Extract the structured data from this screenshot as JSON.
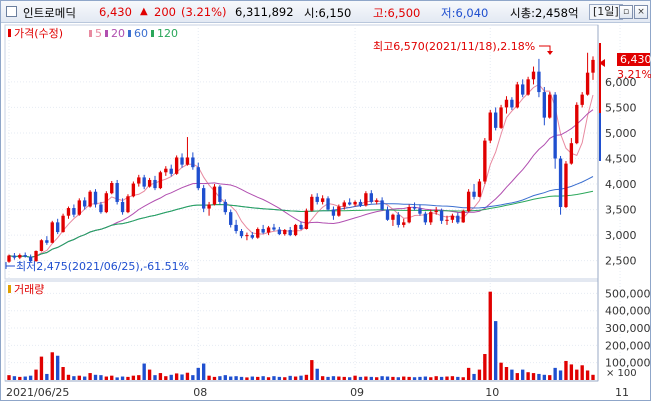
{
  "titlebar": {
    "stock_name": "인트로메딕",
    "price": "6,430",
    "change_arrow": "▲",
    "change": "200",
    "change_pct": "(3.21%)",
    "volume": "6,311,892",
    "open_label": "시:6,150",
    "high_label": "고:6,500",
    "low_label": "저:6,040",
    "mcap_label": "시총:2,458억",
    "period": "[1일]",
    "btn_restore": "▫",
    "btn_close": "×"
  },
  "price_panel": {
    "legend": {
      "price": "가격(수정)",
      "ma5": "5",
      "ma20": "20",
      "ma60": "60",
      "ma120": "120"
    },
    "high_note": "최고6,570(2021/11/18),2.18%",
    "low_note": "최저2,475(2021/06/25),-61.51%",
    "current_price": "6,430",
    "current_pct": "3.21%"
  },
  "volume_panel": {
    "legend": "거래량",
    "unit": "× 100"
  },
  "colors": {
    "up": "#e00000",
    "down": "#1f4fcf",
    "ma5": "#e88aa0",
    "ma20": "#b14fb0",
    "ma60": "#3b6fd0",
    "ma120": "#2aa75a"
  },
  "chart_data": [
    {
      "type": "candlestick",
      "title": "",
      "series_name": "가격(수정)",
      "ylim": [
        2200,
        6800
      ],
      "y_ticks": [
        "6,000",
        "5,500",
        "5,000",
        "4,500",
        "4,000",
        "3,500",
        "3,000",
        "2,500"
      ],
      "y_tick_values": [
        6000,
        5500,
        5000,
        4500,
        4000,
        3500,
        3000,
        2500
      ],
      "x_tick_labels": [
        "2021/06/25",
        "08",
        "09",
        "10",
        "11"
      ],
      "x_tick_index": [
        0,
        35,
        64,
        89,
        113
      ],
      "candles": [
        [
          2480,
          2620,
          2460,
          2600
        ],
        [
          2600,
          2650,
          2520,
          2560
        ],
        [
          2560,
          2640,
          2530,
          2610
        ],
        [
          2610,
          2660,
          2560,
          2580
        ],
        [
          2580,
          2620,
          2470,
          2490
        ],
        [
          2490,
          2700,
          2480,
          2690
        ],
        [
          2690,
          2920,
          2680,
          2900
        ],
        [
          2900,
          2980,
          2810,
          2850
        ],
        [
          2850,
          3280,
          2840,
          3250
        ],
        [
          3250,
          3320,
          3020,
          3060
        ],
        [
          3060,
          3420,
          3050,
          3380
        ],
        [
          3380,
          3560,
          3320,
          3530
        ],
        [
          3530,
          3600,
          3350,
          3400
        ],
        [
          3400,
          3720,
          3380,
          3680
        ],
        [
          3680,
          3740,
          3500,
          3560
        ],
        [
          3560,
          3880,
          3540,
          3850
        ],
        [
          3850,
          3900,
          3540,
          3600
        ],
        [
          3600,
          3650,
          3420,
          3450
        ],
        [
          3450,
          3860,
          3430,
          3820
        ],
        [
          3820,
          4060,
          3800,
          4020
        ],
        [
          4020,
          4080,
          3600,
          3650
        ],
        [
          3650,
          3720,
          3400,
          3450
        ],
        [
          3450,
          3800,
          3430,
          3760
        ],
        [
          3760,
          4050,
          3740,
          4010
        ],
        [
          4010,
          4180,
          3950,
          4130
        ],
        [
          4130,
          4180,
          3900,
          3950
        ],
        [
          3950,
          4120,
          3930,
          4080
        ],
        [
          4080,
          4160,
          3880,
          3920
        ],
        [
          3920,
          4260,
          3900,
          4230
        ],
        [
          4230,
          4350,
          4160,
          4300
        ],
        [
          4300,
          4380,
          4150,
          4200
        ],
        [
          4200,
          4560,
          4180,
          4520
        ],
        [
          4520,
          4600,
          4320,
          4380
        ],
        [
          4380,
          4920,
          4360,
          4520
        ],
        [
          4520,
          4620,
          4280,
          4330
        ],
        [
          4330,
          4420,
          3880,
          3920
        ],
        [
          3920,
          3980,
          3450,
          3520
        ],
        [
          3520,
          3650,
          3380,
          3600
        ],
        [
          3600,
          4000,
          3580,
          3950
        ],
        [
          3950,
          3980,
          3600,
          3650
        ],
        [
          3650,
          3700,
          3400,
          3450
        ],
        [
          3450,
          3500,
          3150,
          3200
        ],
        [
          3200,
          3300,
          3030,
          3080
        ],
        [
          3080,
          3120,
          2940,
          2980
        ],
        [
          2980,
          3050,
          2900,
          3000
        ],
        [
          3000,
          3060,
          2920,
          2950
        ],
        [
          2950,
          3150,
          2930,
          3120
        ],
        [
          3120,
          3200,
          3020,
          3050
        ],
        [
          3050,
          3180,
          3000,
          3150
        ],
        [
          3150,
          3220,
          3080,
          3110
        ],
        [
          3110,
          3160,
          3000,
          3020
        ],
        [
          3020,
          3120,
          2990,
          3100
        ],
        [
          3100,
          3160,
          2980,
          3000
        ],
        [
          3000,
          3220,
          2980,
          3200
        ],
        [
          3200,
          3260,
          3100,
          3120
        ],
        [
          3120,
          3520,
          3110,
          3480
        ],
        [
          3480,
          3800,
          3460,
          3750
        ],
        [
          3750,
          3820,
          3600,
          3650
        ],
        [
          3650,
          3780,
          3600,
          3720
        ],
        [
          3720,
          3760,
          3480,
          3500
        ],
        [
          3500,
          3560,
          3300,
          3380
        ],
        [
          3380,
          3600,
          3360,
          3560
        ],
        [
          3560,
          3680,
          3500,
          3640
        ],
        [
          3640,
          3720,
          3580,
          3600
        ],
        [
          3600,
          3680,
          3560,
          3650
        ],
        [
          3650,
          3700,
          3550,
          3580
        ],
        [
          3580,
          3860,
          3560,
          3820
        ],
        [
          3820,
          3880,
          3620,
          3650
        ],
        [
          3650,
          3720,
          3600,
          3680
        ],
        [
          3680,
          3740,
          3480,
          3500
        ],
        [
          3500,
          3560,
          3280,
          3300
        ],
        [
          3300,
          3420,
          3180,
          3400
        ],
        [
          3400,
          3450,
          3150,
          3200
        ],
        [
          3200,
          3320,
          3150,
          3250
        ],
        [
          3250,
          3600,
          3230,
          3550
        ],
        [
          3550,
          3640,
          3480,
          3520
        ],
        [
          3520,
          3600,
          3380,
          3420
        ],
        [
          3420,
          3460,
          3200,
          3250
        ],
        [
          3250,
          3500,
          3200,
          3450
        ],
        [
          3450,
          3550,
          3400,
          3480
        ],
        [
          3480,
          3520,
          3220,
          3280
        ],
        [
          3280,
          3380,
          3200,
          3300
        ],
        [
          3300,
          3420,
          3240,
          3380
        ],
        [
          3380,
          3440,
          3220,
          3250
        ],
        [
          3250,
          3500,
          3240,
          3470
        ],
        [
          3470,
          3900,
          3450,
          3850
        ],
        [
          3850,
          4000,
          3700,
          3750
        ],
        [
          3750,
          4100,
          3740,
          4050
        ],
        [
          4050,
          4900,
          4000,
          4850
        ],
        [
          4850,
          5450,
          4800,
          5400
        ],
        [
          5400,
          5500,
          5050,
          5100
        ],
        [
          5100,
          5550,
          5080,
          5500
        ],
        [
          5500,
          5720,
          5380,
          5650
        ],
        [
          5650,
          5700,
          5450,
          5500
        ],
        [
          5500,
          6000,
          5480,
          5950
        ],
        [
          5950,
          6050,
          5700,
          5750
        ],
        [
          5750,
          6100,
          5730,
          6050
        ],
        [
          6050,
          6300,
          5950,
          6200
        ],
        [
          6200,
          6450,
          5700,
          5800
        ],
        [
          5800,
          5900,
          5150,
          5300
        ],
        [
          5300,
          5800,
          5280,
          5750
        ],
        [
          5750,
          5800,
          4300,
          4500
        ],
        [
          4500,
          4550,
          3400,
          3550
        ],
        [
          3550,
          4450,
          3530,
          4400
        ],
        [
          4400,
          4900,
          4380,
          4800
        ],
        [
          4800,
          5600,
          4780,
          5550
        ],
        [
          5550,
          5800,
          5500,
          5750
        ],
        [
          5750,
          6570,
          5730,
          6180
        ],
        [
          6180,
          6500,
          6040,
          6430
        ]
      ]
    },
    {
      "type": "bar",
      "title": "",
      "series_name": "거래량",
      "ylim": [
        0,
        560000
      ],
      "y_ticks": [
        "500,000",
        "400,000",
        "300,000",
        "200,000",
        "100,000"
      ],
      "y_tick_values": [
        500000,
        400000,
        300000,
        200000,
        100000
      ],
      "values": [
        28000,
        22000,
        18000,
        20000,
        25000,
        60000,
        135000,
        35000,
        160000,
        140000,
        75000,
        30000,
        22000,
        25000,
        20000,
        40000,
        30000,
        28000,
        20000,
        25000,
        15000,
        20000,
        18000,
        25000,
        28000,
        95000,
        60000,
        28000,
        40000,
        22000,
        30000,
        38000,
        32000,
        42000,
        28000,
        70000,
        95000,
        25000,
        18000,
        22000,
        28000,
        20000,
        22000,
        18000,
        15000,
        20000,
        18000,
        22000,
        16000,
        22000,
        18000,
        16000,
        24000,
        20000,
        25000,
        30000,
        115000,
        65000,
        22000,
        18000,
        22000,
        20000,
        18000,
        16000,
        25000,
        18000,
        20000,
        18000,
        16000,
        22000,
        20000,
        18000,
        16000,
        20000,
        18000,
        16000,
        18000,
        20000,
        16000,
        22000,
        18000,
        20000,
        22000,
        18000,
        16000,
        70000,
        35000,
        60000,
        150000,
        510000,
        340000,
        100000,
        75000,
        60000,
        40000,
        60000,
        45000,
        40000,
        35000,
        30000,
        28000,
        70000,
        55000,
        110000,
        90000,
        60000,
        85000,
        55000,
        30000,
        90000,
        70000,
        40000
      ]
    }
  ]
}
